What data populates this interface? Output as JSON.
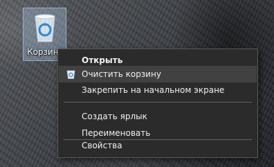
{
  "desktop": {
    "icon_label": "Корзина",
    "icon_name": "recycle-bin-icon"
  },
  "context_menu": {
    "items": [
      {
        "label": "Открыть",
        "bold": true
      },
      {
        "label": "Очистить корзину",
        "icon": "recycle-bin-small-icon",
        "highlighted": true
      },
      {
        "label": "Закрепить на начальном экране"
      },
      {
        "label": "Создать ярлык"
      },
      {
        "label": "Переименовать"
      },
      {
        "label": "Свойства"
      }
    ]
  },
  "colors": {
    "menu_background": "#2b2b2b",
    "menu_highlight": "#414141",
    "menu_text": "#f2f2f2",
    "selection": "#adcdeb"
  }
}
